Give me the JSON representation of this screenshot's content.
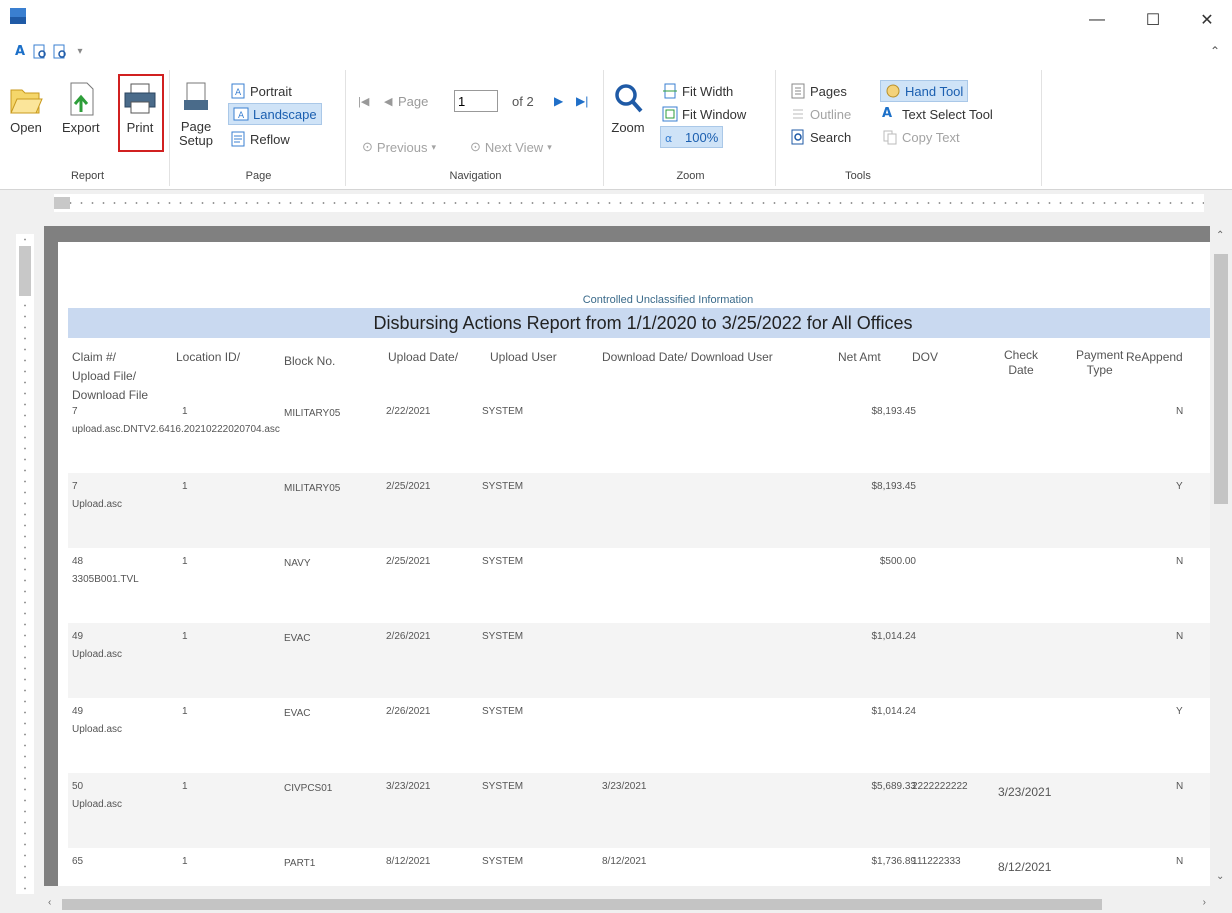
{
  "window": {
    "minimize": "—",
    "maximize": "☐",
    "close": "✕"
  },
  "ribbon": {
    "report": {
      "label": "Report",
      "open": "Open",
      "export": "Export",
      "print": "Print"
    },
    "page": {
      "label": "Page",
      "setup_line1": "Page",
      "setup_line2": "Setup",
      "portrait": "Portrait",
      "landscape": "Landscape",
      "reflow": "Reflow"
    },
    "navigation": {
      "label": "Navigation",
      "page_label": "Page",
      "page_value": "1",
      "of_pages": "of 2",
      "previous": "Previous",
      "next_view": "Next View"
    },
    "zoom": {
      "label": "Zoom",
      "zoom": "Zoom",
      "fit_width": "Fit Width",
      "fit_window": "Fit Window",
      "hundred": "100%"
    },
    "tools": {
      "label": "Tools",
      "pages": "Pages",
      "outline": "Outline",
      "search": "Search",
      "hand_tool": "Hand Tool",
      "text_select": "Text Select Tool",
      "copy_text": "Copy Text"
    }
  },
  "report": {
    "cui": "Controlled Unclassified Information",
    "title": "Disbursing Actions Report from 1/1/2020 to 3/25/2022 for All Offices",
    "headers": {
      "claim_line1": "Claim #/",
      "claim_line2": "Upload File/",
      "claim_line3": "Download File",
      "location": "Location ID/",
      "block": "Block No.",
      "upload_date": "Upload Date/",
      "upload_user": "Upload User",
      "download": "Download Date/ Download User",
      "net_amt": "Net Amt",
      "dov": "DOV",
      "check_line1": "Check",
      "check_line2": "Date",
      "payment_line1": "Payment",
      "payment_line2": "Type",
      "reappend": "ReAppend"
    },
    "rows": [
      {
        "claim": "7",
        "file": "upload.asc.DNTV2.6416.20210222020704.asc",
        "location": "1",
        "block": "MILITARY05",
        "upload_date": "2/22/2021",
        "upload_user": "SYSTEM",
        "download_date": "",
        "net_amt": "$8,193.45",
        "dov": "",
        "check_date": "",
        "reappend": "N"
      },
      {
        "claim": "7",
        "file": "Upload.asc",
        "location": "1",
        "block": "MILITARY05",
        "upload_date": "2/25/2021",
        "upload_user": "SYSTEM",
        "download_date": "",
        "net_amt": "$8,193.45",
        "dov": "",
        "check_date": "",
        "reappend": "Y"
      },
      {
        "claim": "48",
        "file": "3305B001.TVL",
        "location": "1",
        "block": "NAVY",
        "upload_date": "2/25/2021",
        "upload_user": "SYSTEM",
        "download_date": "",
        "net_amt": "$500.00",
        "dov": "",
        "check_date": "",
        "reappend": "N"
      },
      {
        "claim": "49",
        "file": "Upload.asc",
        "location": "1",
        "block": "EVAC",
        "upload_date": "2/26/2021",
        "upload_user": "SYSTEM",
        "download_date": "",
        "net_amt": "$1,014.24",
        "dov": "",
        "check_date": "",
        "reappend": "N"
      },
      {
        "claim": "49",
        "file": "Upload.asc",
        "location": "1",
        "block": "EVAC",
        "upload_date": "2/26/2021",
        "upload_user": "SYSTEM",
        "download_date": "",
        "net_amt": "$1,014.24",
        "dov": "",
        "check_date": "",
        "reappend": "Y"
      },
      {
        "claim": "50",
        "file": "Upload.asc",
        "location": "1",
        "block": "CIVPCS01",
        "upload_date": "3/23/2021",
        "upload_user": "SYSTEM",
        "download_date": "3/23/2021",
        "net_amt": "$5,689.33",
        "dov": "2222222222",
        "check_date": "3/23/2021",
        "reappend": "N"
      },
      {
        "claim": "65",
        "file": "",
        "location": "1",
        "block": "PART1",
        "upload_date": "8/12/2021",
        "upload_user": "SYSTEM",
        "download_date": "8/12/2021",
        "net_amt": "$1,736.89",
        "dov": "111222333",
        "check_date": "8/12/2021",
        "reappend": "N"
      }
    ]
  }
}
